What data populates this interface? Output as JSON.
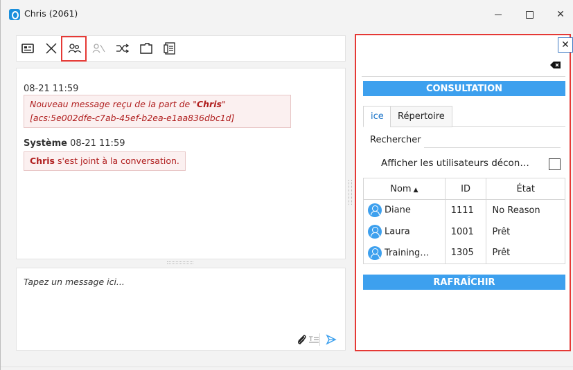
{
  "window": {
    "title": "Chris (2061)",
    "controls": {
      "minimize": "",
      "maximize": "",
      "close": "✕"
    }
  },
  "toolbar": {
    "icons": [
      "contact-card-icon",
      "end-conversation-icon",
      "consult-users-icon",
      "conference-icon",
      "transfer-icon",
      "folder-icon",
      "notes-icon"
    ]
  },
  "chat": {
    "messages": [
      {
        "time": "08-21 11:59",
        "sender": "",
        "text_prefix": "Nouveau message reçu de la part de \"",
        "text_sender": "Chris",
        "text_suffix": "\"",
        "text_line2": "[acs:5e002dfe-c7ab-45ef-b2ea-e1aa836dbc1d]"
      },
      {
        "time": "08-21 11:59",
        "sender": "Système",
        "text_bold": "Chris",
        "text_rest": " s'est joint à la conversation."
      }
    ]
  },
  "compose": {
    "placeholder": "Tapez un message ici..."
  },
  "consultation": {
    "title": "CONSULTATION",
    "tabs": [
      {
        "label": "ice",
        "active": true
      },
      {
        "label": "Répertoire",
        "active": false
      }
    ],
    "search_label": "Rechercher",
    "search_value": "",
    "show_disconnected_label": "Afficher les utilisateurs décon…",
    "show_disconnected_checked": false,
    "columns": [
      "Nom",
      "ID",
      "État"
    ],
    "sort_indicator": "▲",
    "users": [
      {
        "name": "Diane",
        "id": "1111",
        "state": "No Reason"
      },
      {
        "name": "Laura",
        "id": "1001",
        "state": "Prêt"
      },
      {
        "name": "Training…",
        "id": "1305",
        "state": "Prêt"
      }
    ],
    "refresh_label": "RAFRAÎCHIR"
  },
  "colors": {
    "accent": "#3da0ee",
    "highlight_border": "#e53935",
    "message_text": "#b01e1e",
    "message_bg": "#fbf0f0"
  }
}
